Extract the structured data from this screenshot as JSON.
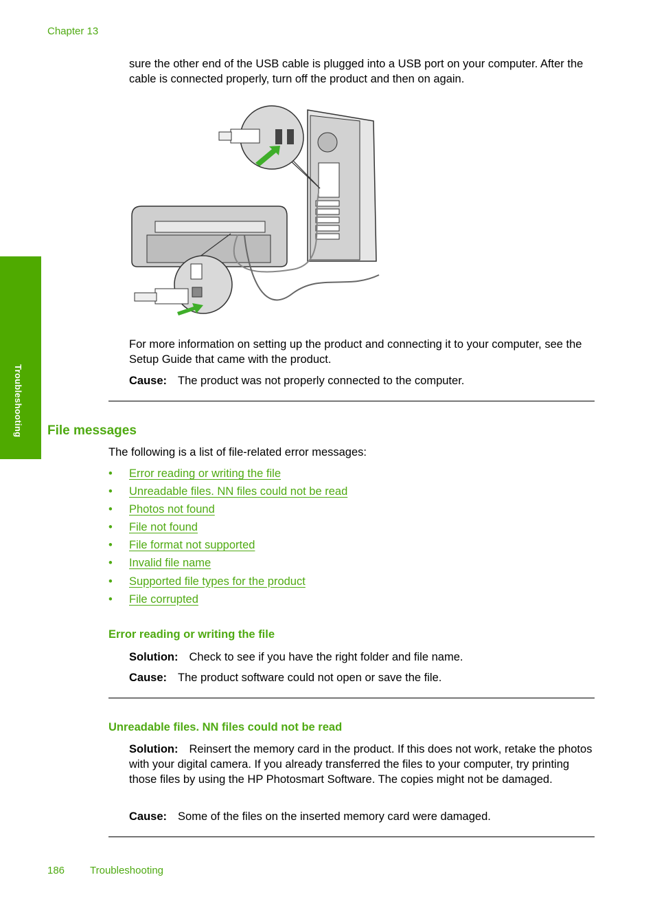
{
  "header": {
    "chapter": "Chapter 13"
  },
  "side_tab": {
    "label": "Troubleshooting"
  },
  "top_text": {
    "continuation": "sure the other end of the USB cable is plugged into a USB port on your computer. After the cable is connected properly, turn off the product and then on again.",
    "more_info": "For more information on setting up the product and connecting it to your computer, see the Setup Guide that came with the product.",
    "cause_label": "Cause:",
    "cause_text": "The product was not properly connected to the computer."
  },
  "figure": {
    "description": "Illustration: USB cable connecting rear of HP printer to USB port on computer tower",
    "accent_color": "#3fae2a"
  },
  "file_messages": {
    "heading": "File messages",
    "intro": "The following is a list of file-related error messages:",
    "links": [
      {
        "label": "Error reading or writing the file"
      },
      {
        "label": "Unreadable files. NN files could not be read"
      },
      {
        "label": "Photos not found"
      },
      {
        "label": "File not found"
      },
      {
        "label": "File format not supported"
      },
      {
        "label": "Invalid file name"
      },
      {
        "label": "Supported file types for the product"
      },
      {
        "label": "File corrupted"
      }
    ],
    "bullet": "•"
  },
  "sections": [
    {
      "heading": "Error reading or writing the file",
      "solution_label": "Solution:",
      "solution_text": "Check to see if you have the right folder and file name.",
      "cause_label": "Cause:",
      "cause_text": "The product software could not open or save the file."
    },
    {
      "heading": "Unreadable files. NN files could not be read",
      "solution_label": "Solution:",
      "solution_text": "Reinsert the memory card in the product. If this does not work, retake the photos with your digital camera. If you already transferred the files to your computer, try printing those files by using the HP Photosmart Software. The copies might not be damaged.",
      "cause_label": "Cause:",
      "cause_text": "Some of the files on the inserted memory card were damaged."
    }
  ],
  "footer": {
    "page_number": "186",
    "section": "Troubleshooting"
  },
  "colors": {
    "brand_green": "#4faa12",
    "tab_green": "#4faa00"
  }
}
